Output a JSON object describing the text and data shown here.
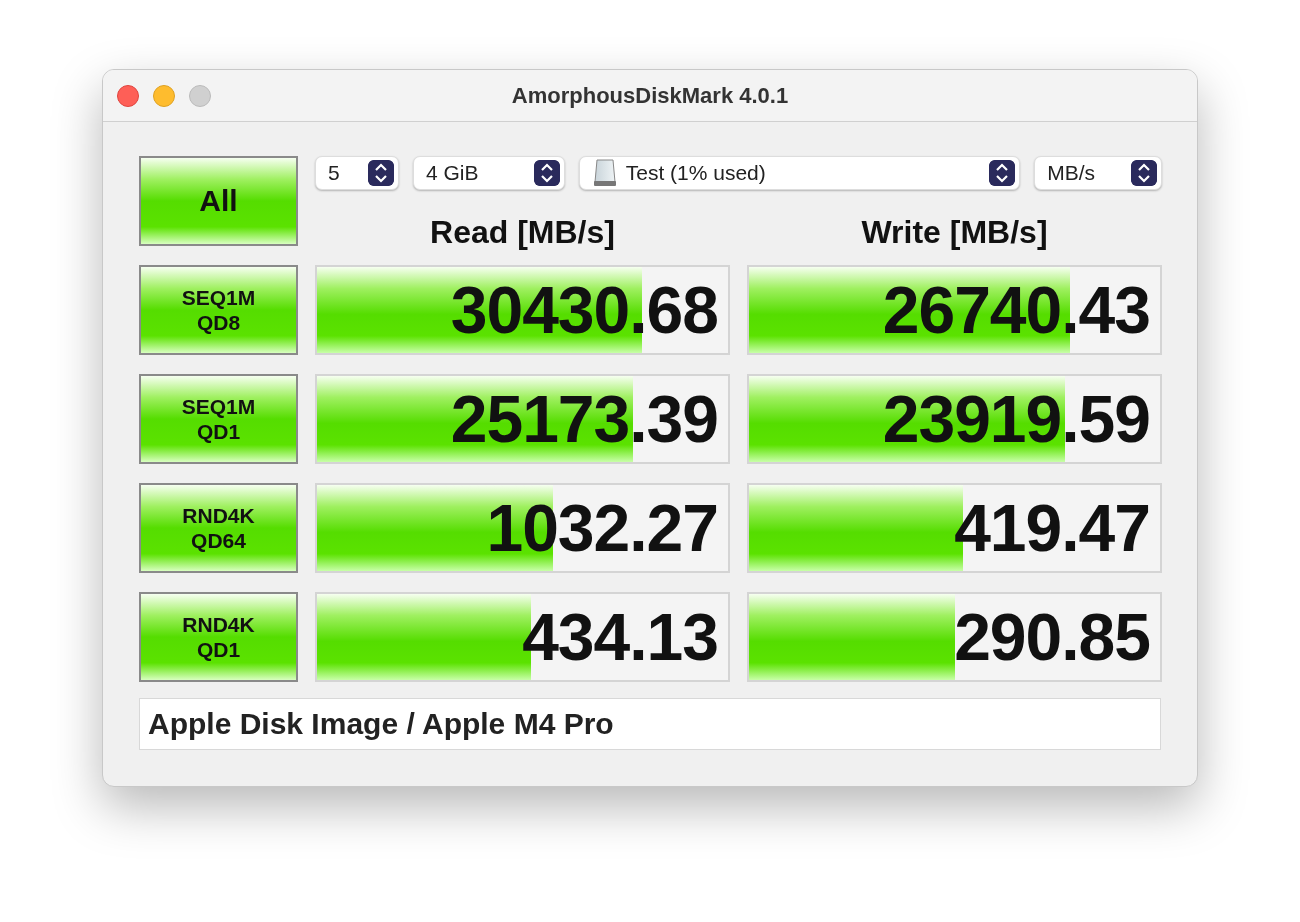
{
  "window": {
    "title": "AmorphousDiskMark 4.0.1"
  },
  "all_button": {
    "label": "All"
  },
  "selectors": [
    {
      "kind": "plain",
      "value": "5"
    },
    {
      "kind": "plain",
      "value": "4 GiB"
    },
    {
      "kind": "drive",
      "value": "Test (1% used)"
    },
    {
      "kind": "plain",
      "value": "MB/s"
    }
  ],
  "headers": [
    "Read [MB/s]",
    "Write [MB/s]"
  ],
  "rows": [
    {
      "test": [
        "SEQ1M",
        "QD8"
      ],
      "read": {
        "value": "30430.68",
        "level": 0.79
      },
      "write": {
        "value": "26740.43",
        "level": 0.78
      }
    },
    {
      "test": [
        "SEQ1M",
        "QD1"
      ],
      "read": {
        "value": "25173.39",
        "level": 0.77
      },
      "write": {
        "value": "23919.59",
        "level": 0.77
      }
    },
    {
      "test": [
        "RND4K",
        "QD64"
      ],
      "read": {
        "value": "1032.27",
        "level": 0.575
      },
      "write": {
        "value": "419.47",
        "level": 0.52
      }
    },
    {
      "test": [
        "RND4K",
        "QD1"
      ],
      "read": {
        "value": "434.13",
        "level": 0.52
      },
      "write": {
        "value": "290.85",
        "level": 0.5
      }
    }
  ],
  "comment": "Apple Disk Image / Apple M4 Pro"
}
